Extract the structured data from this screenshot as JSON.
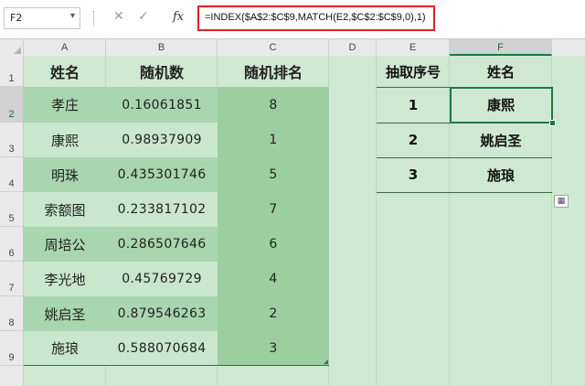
{
  "formula_bar": {
    "name_box": "F2",
    "formula": "=INDEX($A$2:$C$9,MATCH(E2,$C$2:$C$9,0),1)",
    "cancel_icon": "✕",
    "enter_icon": "✓",
    "fx_label": "fx"
  },
  "columns": [
    "A",
    "B",
    "C",
    "D",
    "E",
    "F"
  ],
  "rows": [
    "1",
    "2",
    "3",
    "4",
    "5",
    "6",
    "7",
    "8",
    "9"
  ],
  "left_table": {
    "headers": [
      "姓名",
      "随机数",
      "随机排名"
    ],
    "rows": [
      {
        "name": "孝庄",
        "random": "0.16061851",
        "rank": "8"
      },
      {
        "name": "康熙",
        "random": "0.98937909",
        "rank": "1"
      },
      {
        "name": "明珠",
        "random": "0.435301746",
        "rank": "5"
      },
      {
        "name": "索额图",
        "random": "0.233817102",
        "rank": "7"
      },
      {
        "name": "周培公",
        "random": "0.286507646",
        "rank": "6"
      },
      {
        "name": "李光地",
        "random": "0.45769729",
        "rank": "4"
      },
      {
        "name": "姚启圣",
        "random": "0.879546263",
        "rank": "2"
      },
      {
        "name": "施琅",
        "random": "0.588070684",
        "rank": "3"
      }
    ]
  },
  "right_table": {
    "headers": [
      "抽取序号",
      "姓名"
    ],
    "rows": [
      {
        "index": "1",
        "name": "康熙"
      },
      {
        "index": "2",
        "name": "姚启圣"
      },
      {
        "index": "3",
        "name": "施琅"
      }
    ]
  },
  "active_cell": "F2",
  "colors": {
    "active_border": "#1d7a3a",
    "formula_highlight": "#e02020",
    "sheet_bg": "#cfe8d2"
  }
}
